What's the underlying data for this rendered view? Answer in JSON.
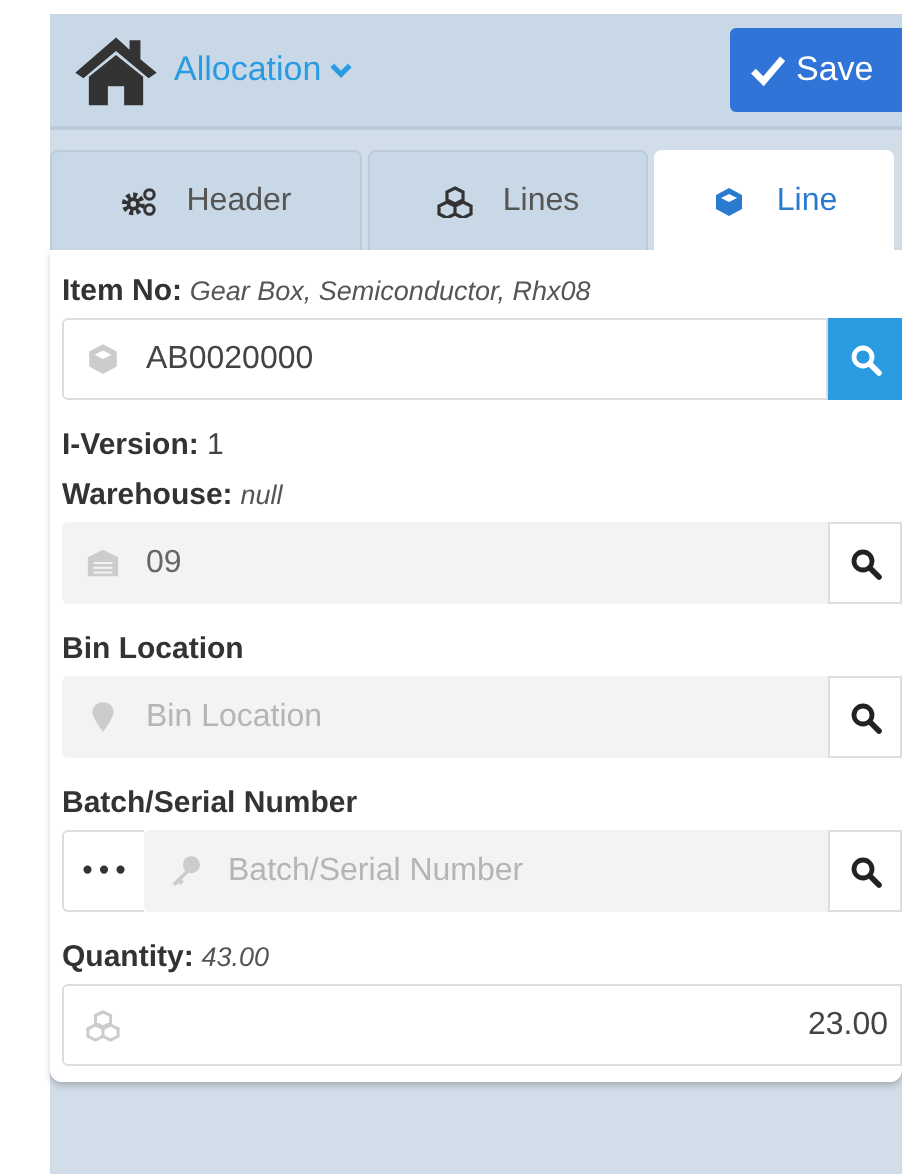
{
  "header": {
    "title": "Allocation",
    "save_button": "Save"
  },
  "tabs": [
    {
      "label": "Header",
      "selected": false
    },
    {
      "label": "Lines",
      "selected": false
    },
    {
      "label": "Line",
      "selected": true
    }
  ],
  "fields": [
    {
      "kind": "lookup",
      "label": "Item No:",
      "note": "Gear Box, Semiconductor, Rhx08",
      "value": "AB0020000",
      "disabled": false
    },
    {
      "kind": "info",
      "label": "I-Version:",
      "value": "1"
    },
    {
      "kind": "lookup",
      "label": "Warehouse:",
      "note": "null",
      "value": "09",
      "disabled": true
    },
    {
      "kind": "lookup",
      "label": "Bin Location",
      "placeholder": "Bin Location",
      "disabled": true
    },
    {
      "kind": "lookup",
      "label": "Batch/Serial Number",
      "placeholder": "Batch/Serial Number",
      "disabled": true,
      "menu_button": "•••"
    },
    {
      "kind": "number",
      "label": "Quantity:",
      "note": "43.00",
      "value": "23.00"
    }
  ]
}
